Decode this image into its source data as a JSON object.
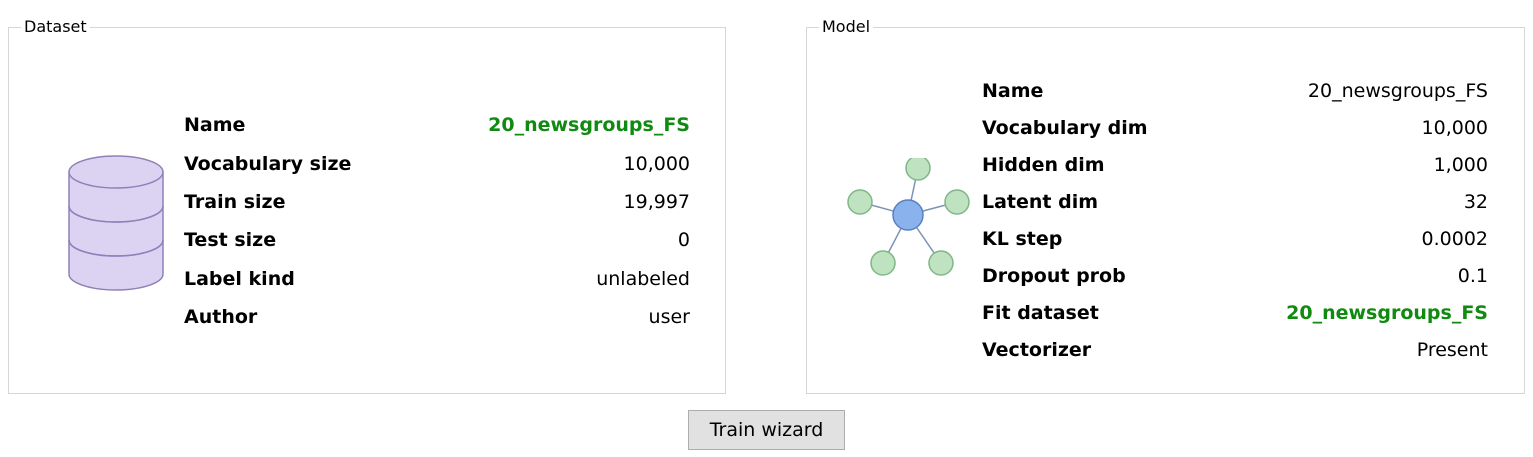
{
  "colors": {
    "accent_green": "#118a11",
    "db_fill": "#dcd3f3",
    "db_stroke": "#8f80b8",
    "node_center": "#8ab2ec",
    "node_center_stroke": "#5b7fc0",
    "node_outer": "#bfe3c1",
    "node_outer_stroke": "#7fb786",
    "edge": "#7d93b5"
  },
  "dataset": {
    "title": "Dataset",
    "icon": "database-icon",
    "fields": [
      {
        "label": "Name",
        "value": "20_newsgroups_FS",
        "highlight": true
      },
      {
        "label": "Vocabulary size",
        "value": "10,000"
      },
      {
        "label": "Train size",
        "value": "19,997"
      },
      {
        "label": "Test size",
        "value": "0"
      },
      {
        "label": "Label kind",
        "value": "unlabeled"
      },
      {
        "label": "Author",
        "value": "user"
      }
    ]
  },
  "model": {
    "title": "Model",
    "icon": "network-icon",
    "fields": [
      {
        "label": "Name",
        "value": "20_newsgroups_FS"
      },
      {
        "label": "Vocabulary dim",
        "value": "10,000"
      },
      {
        "label": "Hidden dim",
        "value": "1,000"
      },
      {
        "label": "Latent dim",
        "value": "32"
      },
      {
        "label": "KL step",
        "value": "0.0002"
      },
      {
        "label": "Dropout prob",
        "value": "0.1"
      },
      {
        "label": "Fit dataset",
        "value": "20_newsgroups_FS",
        "highlight": true
      },
      {
        "label": "Vectorizer",
        "value": "Present"
      }
    ]
  },
  "actions": {
    "train_label": "Train wizard"
  }
}
